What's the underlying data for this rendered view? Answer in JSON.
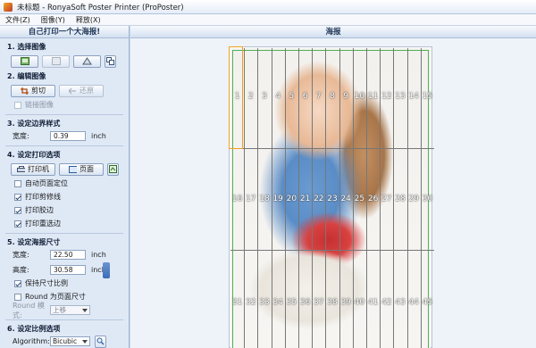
{
  "window": {
    "title": "未标题 - RonyaSoft Poster Printer (ProPoster)"
  },
  "menu": [
    "文件(Z)",
    "图像(Y)",
    "释放(X)"
  ],
  "left": {
    "header": "自己打印一个大海报!",
    "s1_title": "1. 选择图像",
    "s2_title": "2. 编辑图像",
    "crop_label": "剪切",
    "restore_label": "还原",
    "link_label": "链接图像",
    "s3_title": "3. 设定边界样式",
    "border_width_label": "宽度:",
    "border_width_value": "0.39",
    "border_unit": "inch",
    "s4_title": "4. 设定打印选项",
    "printer_label": "打印机",
    "page_label": "页面",
    "auto_page": "自动页面定位",
    "print_cut": "打印剪修线",
    "print_overlap": "打印胶边",
    "print_overlap_edge": "打印重选边",
    "s5_title": "5. 设定海报尺寸",
    "width_label": "宽度:",
    "width_value": "22.50",
    "width_unit": "inch",
    "height_label": "高度:",
    "height_value": "30.58",
    "height_unit": "inch",
    "keep_ratio": "保持尺寸比例",
    "round_page": "Round 为页面尺寸",
    "round_mode_label": "Round 模式:",
    "round_mode_value": "上移",
    "s6_title": "6. 设定比例选项",
    "algo_label": "Algorithm:",
    "algo_value": "Bicubic"
  },
  "right": {
    "header": "海报"
  },
  "tiles": [
    "1",
    "2",
    "3",
    "4",
    "5",
    "6",
    "7",
    "8",
    "9",
    "10",
    "11",
    "12",
    "13",
    "14",
    "15",
    "16",
    "17",
    "18",
    "19",
    "20",
    "21",
    "22",
    "23",
    "24",
    "25",
    "26",
    "27",
    "28",
    "29",
    "30",
    "31",
    "32",
    "33",
    "34",
    "35",
    "36",
    "37",
    "38",
    "39",
    "40",
    "41",
    "42",
    "43",
    "44",
    "45"
  ],
  "colors": {
    "accent": "#3c6db6",
    "selection": "#f0a020",
    "margin_frame": "#4fb255"
  }
}
